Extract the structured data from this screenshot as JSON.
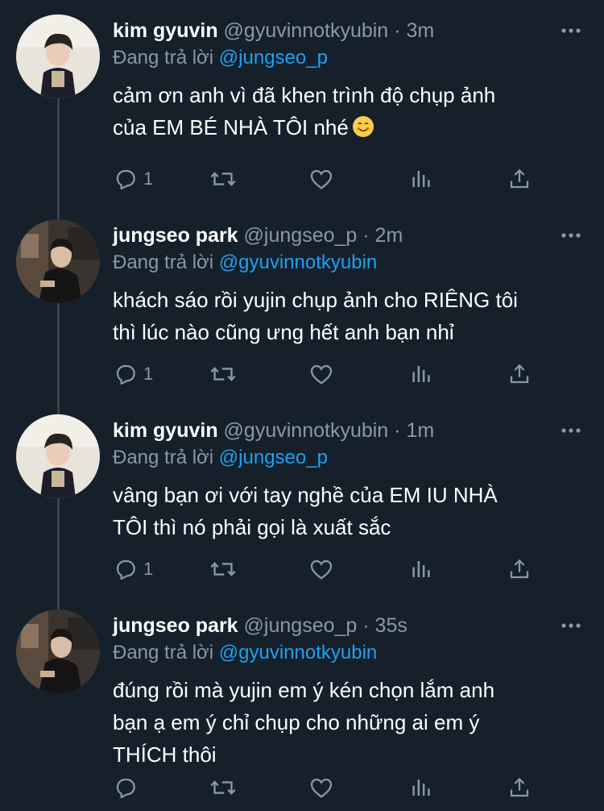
{
  "tweets": [
    {
      "name": "kim gyuvin",
      "handle": "@gyuvinnotkyubin",
      "dot": "·",
      "time": "3m",
      "reply_prefix": "Đang trả lời",
      "reply_to": "@jungseo_p",
      "text": "cảm ơn anh vì đã khen trình độ chụp ảnh\ncủa EM BÉ NHÀ TÔI nhé",
      "emoji": "smiling-face-emoji",
      "reply_count": "1"
    },
    {
      "name": "jungseo park",
      "handle": "@jungseo_p",
      "dot": "·",
      "time": "2m",
      "reply_prefix": "Đang trả lời",
      "reply_to": "@gyuvinnotkyubin",
      "text": "khách sáo rồi yujin chụp ảnh cho RIÊNG tôi\nthì lúc nào cũng ưng hết anh bạn nhỉ",
      "reply_count": "1"
    },
    {
      "name": "kim gyuvin",
      "handle": "@gyuvinnotkyubin",
      "dot": "·",
      "time": "1m",
      "reply_prefix": "Đang trả lời",
      "reply_to": "@jungseo_p",
      "text": "vâng bạn ơi với tay nghề của EM IU NHÀ\nTÔI thì nó phải gọi là xuất sắc",
      "reply_count": "1"
    },
    {
      "name": "jungseo park",
      "handle": "@jungseo_p",
      "dot": "·",
      "time": "35s",
      "reply_prefix": "Đang trả lời",
      "reply_to": "@gyuvinnotkyubin",
      "text": "đúng rồi mà yujin em ý kén chọn lắm anh\nbạn ạ em ý chỉ chụp cho những ai em ý\nTHÍCH thôi",
      "reply_count": ""
    }
  ],
  "colors": {
    "background": "#15202b",
    "muted": "#8899a6",
    "link": "#1da1f2",
    "thread_line": "#38444d"
  }
}
